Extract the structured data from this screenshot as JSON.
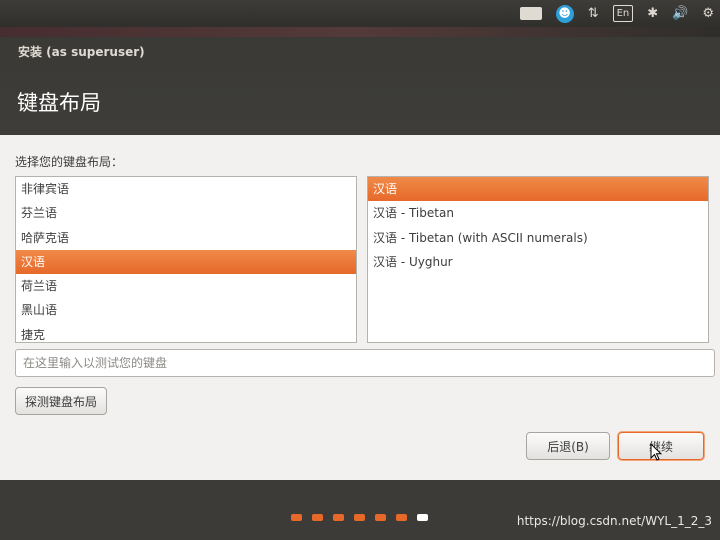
{
  "panel": {
    "keyboard_icon": "keyboard-icon",
    "accessibility_icon": "accessibility-icon",
    "network_glyph": "⇅",
    "language_indicator": "En",
    "bluetooth_glyph": "✱",
    "volume_glyph": "🔊",
    "settings_glyph": "⚙"
  },
  "window": {
    "title": "安装 (as superuser)",
    "heading": "键盘布局"
  },
  "main": {
    "prompt": "选择您的键盘布局：",
    "layouts": [
      {
        "label": "非律宾语",
        "selected": false
      },
      {
        "label": "芬兰语",
        "selected": false
      },
      {
        "label": "哈萨克语",
        "selected": false
      },
      {
        "label": "汉语",
        "selected": true
      },
      {
        "label": "荷兰语",
        "selected": false
      },
      {
        "label": "黑山语",
        "selected": false
      },
      {
        "label": "捷克",
        "selected": false
      }
    ],
    "variants": [
      {
        "label": "汉语",
        "selected": true
      },
      {
        "label": "汉语 - Tibetan",
        "selected": false
      },
      {
        "label": "汉语 - Tibetan (with ASCII numerals)",
        "selected": false
      },
      {
        "label": "汉语 - Uyghur",
        "selected": false
      }
    ],
    "test_placeholder": "在这里输入以测试您的键盘",
    "detect_label": "探测键盘布局"
  },
  "buttons": {
    "back_label": "后退(B)",
    "continue_label": "继续"
  },
  "progress": {
    "total_steps": 7,
    "current_step": 7
  },
  "watermark": "https://blog.csdn.net/WYL_1_2_3",
  "colors": {
    "accent": "#e6692a",
    "panel": "#3c3b37",
    "content_bg": "#f2f1f0"
  }
}
